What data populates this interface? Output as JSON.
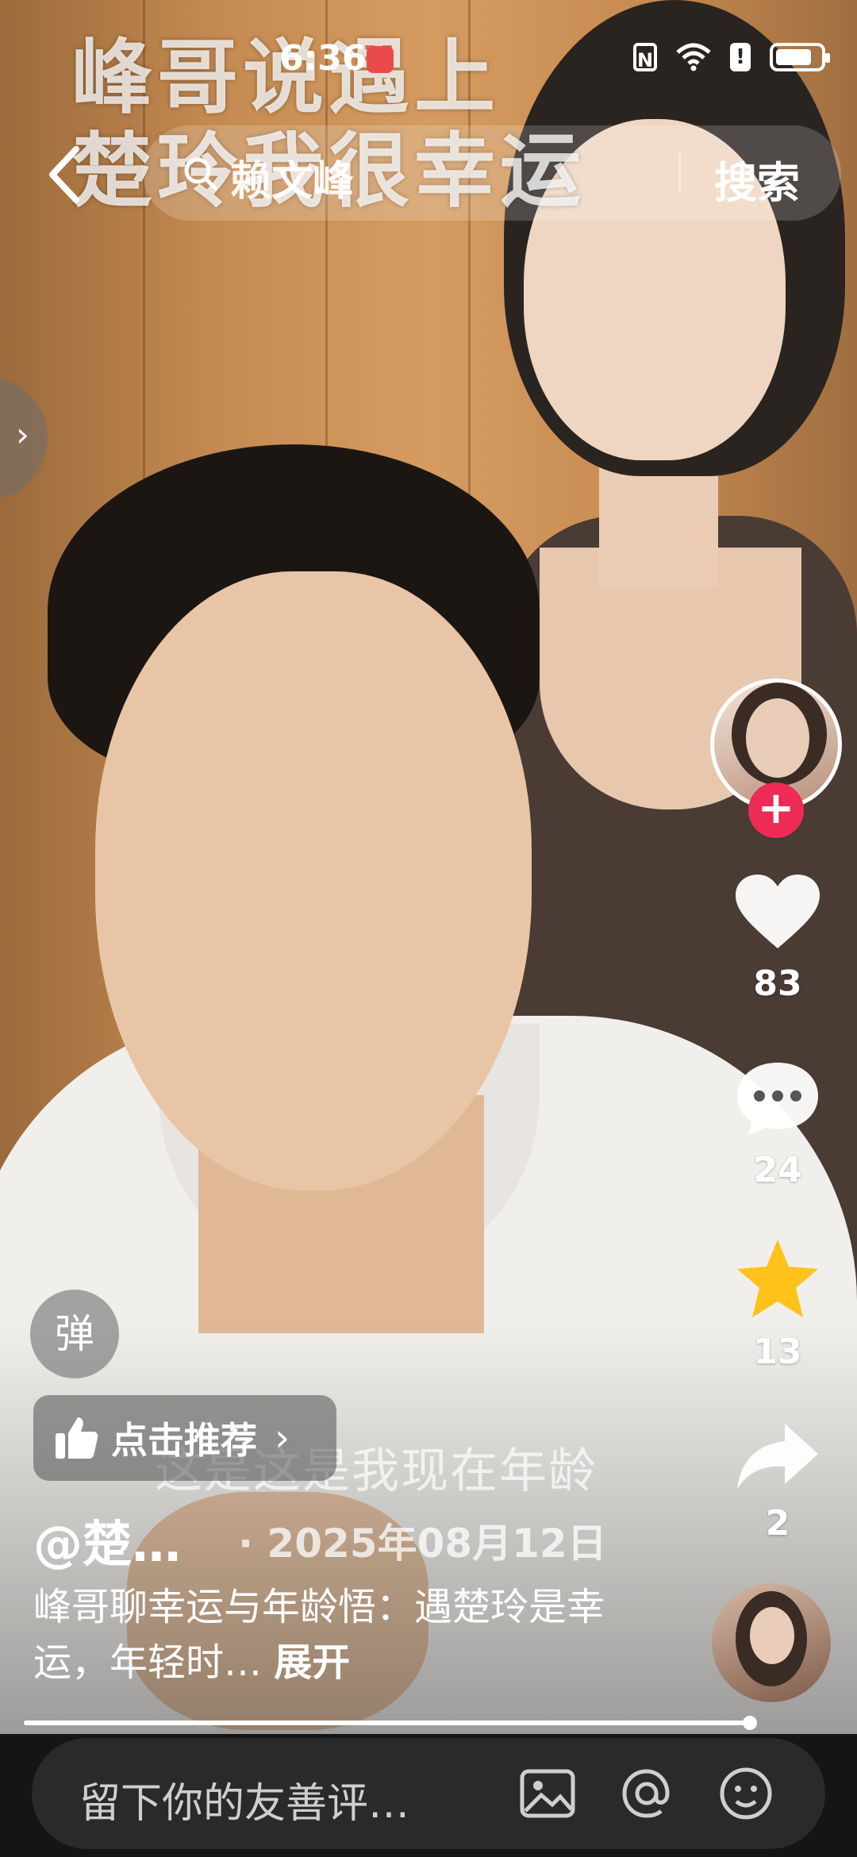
{
  "status_bar": {
    "time": "6:36",
    "nfc": "N"
  },
  "video": {
    "overlay_title": "峰哥说遇上\n楚玲我很幸运",
    "subtitle": "这是这是我现在年龄"
  },
  "top_nav": {
    "search_query": "赖文峰",
    "search_button": "搜索"
  },
  "side_handle": {
    "symbol": "›"
  },
  "actions": {
    "like_count": "83",
    "comment_count": "24",
    "collect_count": "13",
    "share_count": "2",
    "follow_plus": "+",
    "like_color": "#ffffff",
    "collect_color": "#ffc21a"
  },
  "overlay": {
    "danmu_label": "弹",
    "recommend_label": "点击推荐",
    "recommend_chevron": "›",
    "author": "@楚…",
    "post_date": "· 2025年08月12日",
    "description": "峰哥聊幸运与年龄悟：遇楚玲是幸运，年轻时…",
    "expand": "展开"
  },
  "progress": {
    "fraction": 0.99
  },
  "comment_bar": {
    "placeholder": "留下你的友善评…"
  }
}
